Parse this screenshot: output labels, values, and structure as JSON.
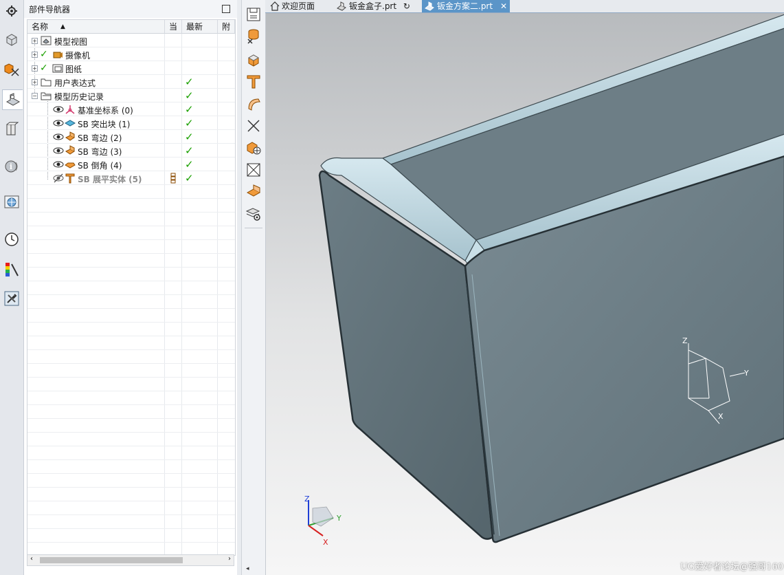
{
  "navigator": {
    "title": "部件导航器",
    "columns": {
      "name": "名称",
      "current": "当",
      "latest": "最新",
      "attach": "附"
    },
    "nodes": [
      {
        "label": "模型视图",
        "icon": "model-views-icon",
        "expander": "+",
        "latest_check": false
      },
      {
        "label": "摄像机",
        "icon": "camera-icon",
        "expander": "+",
        "latest_check": false
      },
      {
        "label": "图纸",
        "icon": "drawing-icon",
        "expander": "+",
        "latest_check": false
      },
      {
        "label": "用户表达式",
        "icon": "folder-icon",
        "expander": "+",
        "latest_check": true
      },
      {
        "label": "模型历史记录",
        "icon": "folder-open-icon",
        "expander": "−",
        "latest_check": true
      }
    ],
    "features": [
      {
        "label": "基准坐标系 (0)",
        "icon": "datum-csys-icon",
        "latest_check": true
      },
      {
        "label": "SB 突出块 (1)",
        "icon": "tab-icon",
        "latest_check": true
      },
      {
        "label": "SB 弯边 (2)",
        "icon": "flange-icon",
        "latest_check": true
      },
      {
        "label": "SB 弯边 (3)",
        "icon": "flange-icon",
        "latest_check": true
      },
      {
        "label": "SB 倒角 (4)",
        "icon": "chamfer-icon",
        "latest_check": true
      },
      {
        "label": "SB 展平实体 (5)",
        "icon": "flat-solid-icon",
        "latest_check": true,
        "suppressed": true
      }
    ]
  },
  "tabs": [
    {
      "label": "欢迎页面",
      "icon": "home-icon",
      "active": false
    },
    {
      "label": "钣金盒子.prt",
      "icon": "part-icon",
      "active": false,
      "suffix": "↻"
    },
    {
      "label": "钣金方案二.prt",
      "icon": "part-icon",
      "active": true,
      "close": "✕"
    }
  ],
  "viewport": {
    "triad_labels": {
      "x": "X",
      "y": "Y",
      "z": "Z"
    },
    "watermark": "UG爱好者论坛@强哥160"
  },
  "colors": {
    "accent_tab": "#5b95c8",
    "check_green": "#1aa000",
    "part_body": "#6f8189",
    "flange_highlight": "#b9d4de",
    "bg_top": "#bfc2c5",
    "bg_bottom": "#f3f3f3"
  }
}
